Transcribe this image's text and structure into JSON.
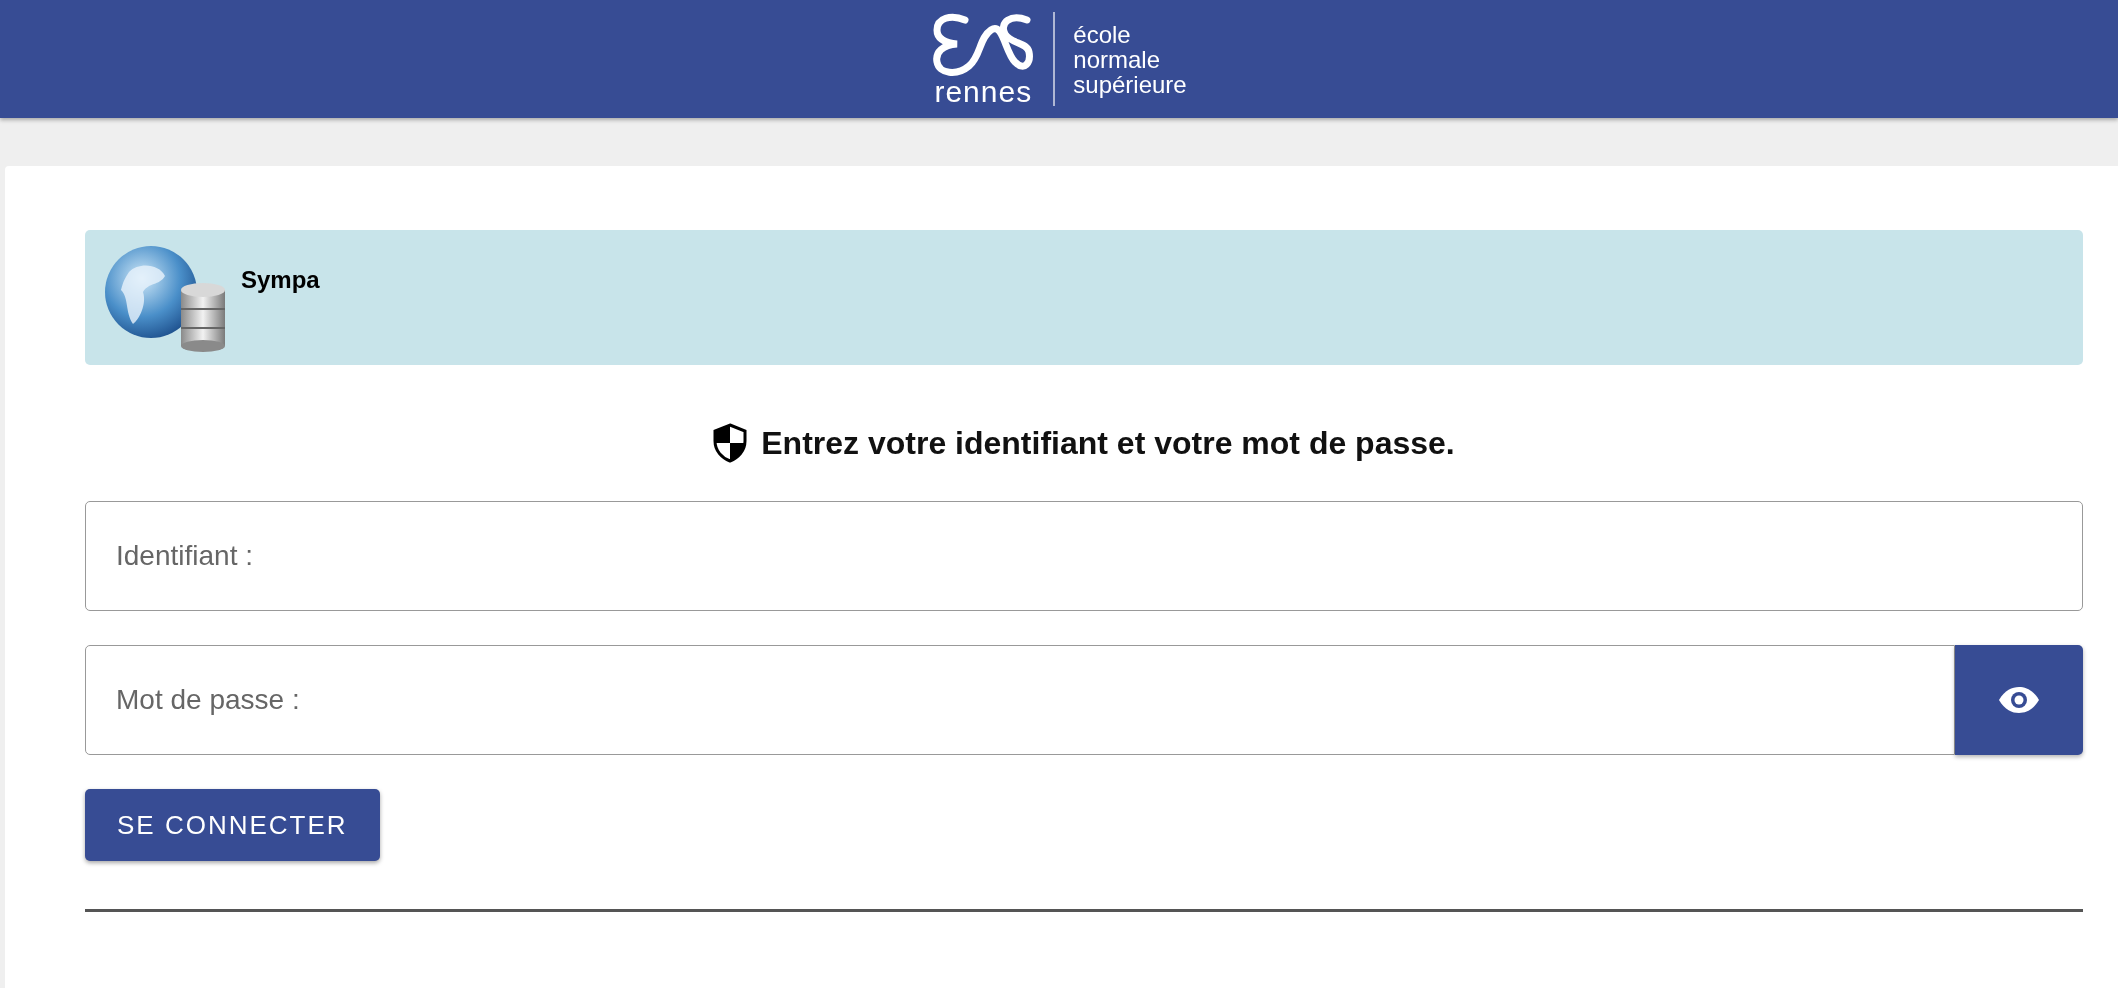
{
  "header": {
    "logo_word": "rennes",
    "logo_lines": [
      "école",
      "normale",
      "supérieure"
    ]
  },
  "banner": {
    "title": "Sympa"
  },
  "heading": "Entrez votre identifiant et votre mot de passe.",
  "fields": [
    {
      "kind": "text",
      "placeholder": "Identifiant :"
    },
    {
      "kind": "password",
      "placeholder": "Mot de passe :"
    }
  ],
  "submit": "SE CONNECTER"
}
